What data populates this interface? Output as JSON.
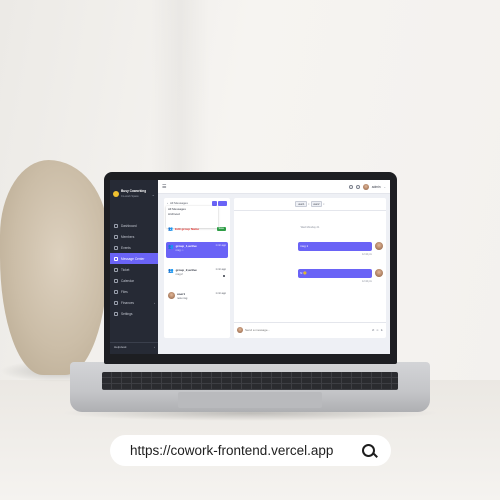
{
  "sidebar": {
    "brand_title": "Busy Coworking",
    "brand_subtitle": "Co-work Space",
    "items": [
      {
        "label": "Dashboard",
        "icon": "grid-icon"
      },
      {
        "label": "Members",
        "icon": "user-icon"
      },
      {
        "label": "Events",
        "icon": "calendar-icon"
      },
      {
        "label": "Message Center",
        "icon": "chat-icon"
      },
      {
        "label": "Ticket",
        "icon": "ticket-icon"
      },
      {
        "label": "Calendar",
        "icon": "calendar-icon"
      },
      {
        "label": "Files",
        "icon": "folder-icon"
      },
      {
        "label": "Finances",
        "icon": "wallet-icon"
      },
      {
        "label": "Settings",
        "icon": "gear-icon"
      }
    ],
    "active_index": 3,
    "profile_label": "Helpdesk"
  },
  "topbar": {
    "user_label": "admin"
  },
  "chat_panel": {
    "filter_label": "All Messages",
    "dropdown_options": [
      "All Messages",
      "Archived"
    ],
    "edit_group_label": "Edit group Name",
    "edit_group_badge": "Save",
    "chats": [
      {
        "name": "group_1,active",
        "last": "msg ☺",
        "time": "1 min ago",
        "active": true
      },
      {
        "name": "group_2,active",
        "last": "msg 2",
        "time": "1 min ago",
        "active": false
      },
      {
        "name": "user1",
        "last": "new msg",
        "time": "1 min ago",
        "active": false
      }
    ]
  },
  "conversation": {
    "tags": [
      "user1",
      "user2"
    ],
    "date_separator": "Wed Monday 21",
    "messages": [
      {
        "text": "msg 1",
        "time": "12:44 pm"
      },
      {
        "text": "hi 😊",
        "time": "12:44 pm"
      }
    ],
    "composer_placeholder": "Send a message..."
  },
  "browser": {
    "url": "https://cowork-frontend.vercel.app",
    "search_icon": "search-icon"
  },
  "colors": {
    "accent": "#6a63f6",
    "sidebar_bg": "#262a35",
    "danger": "#e53935",
    "success": "#2e9d46"
  }
}
